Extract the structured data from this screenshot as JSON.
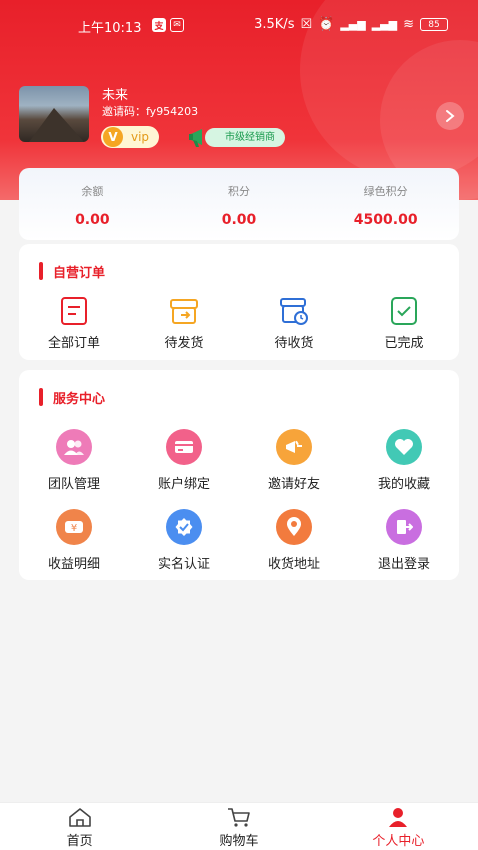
{
  "status_bar": {
    "time": "上午10:13",
    "speed": "3.5K/s",
    "battery": "85"
  },
  "profile": {
    "name": "未来",
    "invite_code": "邀请码：fy954203",
    "vip_label": "vip",
    "vip_letter": "V",
    "dealer_label": "市级经销商"
  },
  "stats": [
    {
      "label": "余额",
      "value": "0.00"
    },
    {
      "label": "积分",
      "value": "0.00"
    },
    {
      "label": "绿色积分",
      "value": "4500.00"
    }
  ],
  "orders": {
    "title": "自营订单",
    "items": [
      {
        "label": "全部订单",
        "icon": "all-orders-icon"
      },
      {
        "label": "待发货",
        "icon": "to-ship-icon"
      },
      {
        "label": "待收货",
        "icon": "to-receive-icon"
      },
      {
        "label": "已完成",
        "icon": "completed-icon"
      }
    ]
  },
  "services": {
    "title": "服务中心",
    "items": [
      {
        "label": "团队管理",
        "icon": "team-icon",
        "color": "#ee7bb8"
      },
      {
        "label": "账户绑定",
        "icon": "card-icon",
        "color": "#f2618a"
      },
      {
        "label": "邀请好友",
        "icon": "megaphone-icon",
        "color": "#f7a43a"
      },
      {
        "label": "我的收藏",
        "icon": "heart-icon",
        "color": "#42c9b5"
      },
      {
        "label": "收益明细",
        "icon": "income-icon",
        "color": "#f0844a"
      },
      {
        "label": "实名认证",
        "icon": "verify-icon",
        "color": "#4b8ef0"
      },
      {
        "label": "收货地址",
        "icon": "location-icon",
        "color": "#f27b3e"
      },
      {
        "label": "退出登录",
        "icon": "logout-icon",
        "color": "#c96ee0"
      }
    ]
  },
  "tabbar": [
    {
      "label": "首页",
      "icon": "home-icon"
    },
    {
      "label": "购物车",
      "icon": "cart-icon"
    },
    {
      "label": "个人中心",
      "icon": "user-icon",
      "active": true
    }
  ],
  "colors": {
    "brand_red": "#e8202a",
    "green_badge": "#1a9a4e",
    "gold": "#f5a623"
  }
}
